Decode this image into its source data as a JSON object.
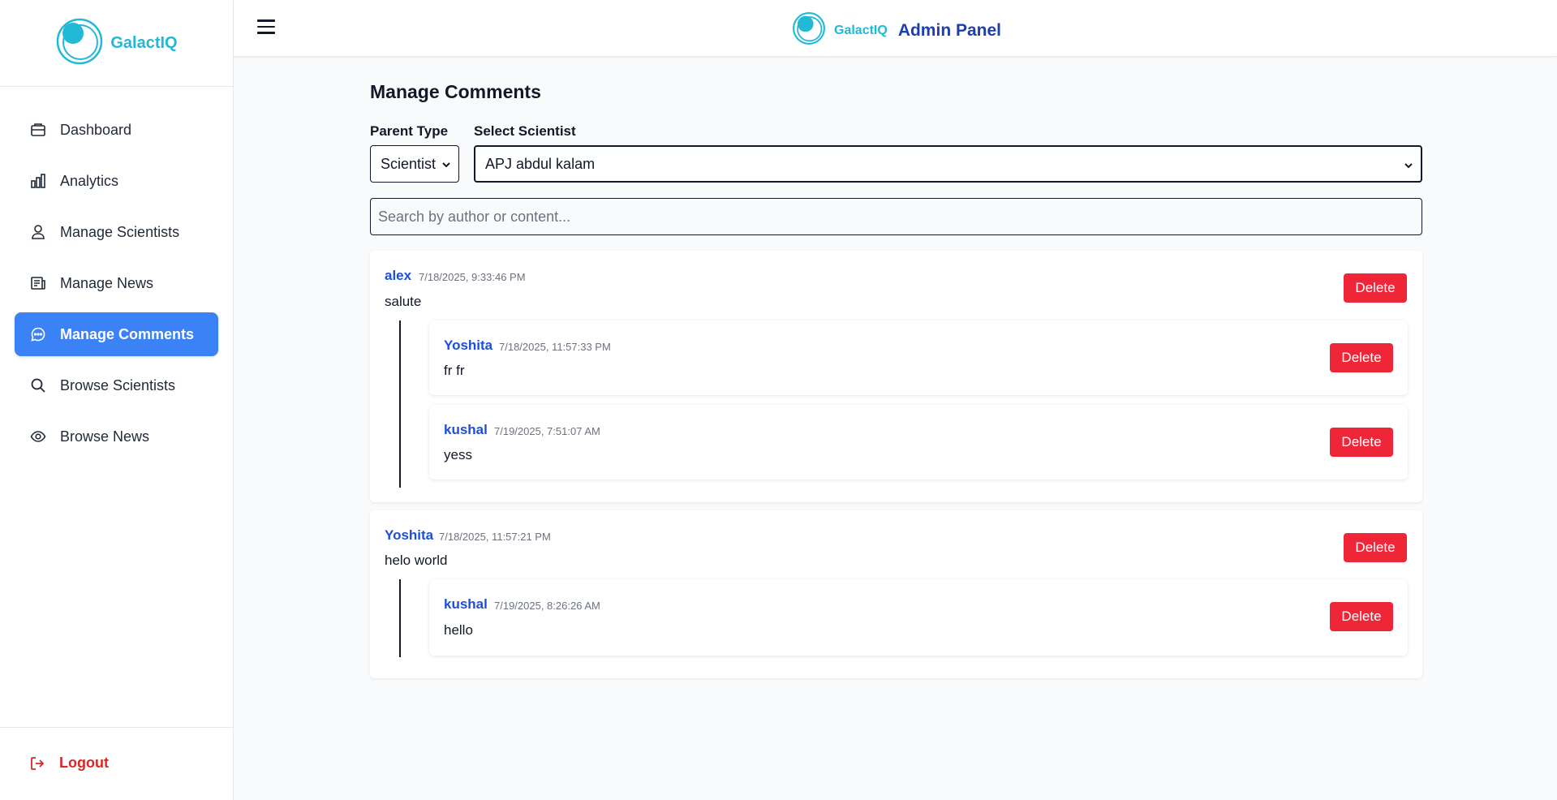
{
  "brand": {
    "name": "GalactIQ"
  },
  "header": {
    "brand": "GalactIQ",
    "title": "Admin Panel"
  },
  "sidebar": {
    "items": [
      {
        "label": "Dashboard",
        "icon": "dashboard-icon"
      },
      {
        "label": "Analytics",
        "icon": "bar-chart-icon"
      },
      {
        "label": "Manage Scientists",
        "icon": "user-icon"
      },
      {
        "label": "Manage News",
        "icon": "newspaper-icon"
      },
      {
        "label": "Manage Comments",
        "icon": "comment-icon",
        "active": true
      },
      {
        "label": "Browse Scientists",
        "icon": "search-icon"
      },
      {
        "label": "Browse News",
        "icon": "eye-icon"
      }
    ],
    "logout": "Logout"
  },
  "main": {
    "title": "Manage Comments",
    "parent_type": {
      "label": "Parent Type",
      "value": "Scientist"
    },
    "scientist": {
      "label": "Select Scientist",
      "value": "APJ abdul kalam"
    },
    "search_placeholder": "Search by author or content...",
    "delete_label": "Delete",
    "comments": [
      {
        "author": "alex",
        "time": "7/18/2025, 9:33:46 PM",
        "text": "salute",
        "replies": [
          {
            "author": "Yoshita",
            "time": "7/18/2025, 11:57:33 PM",
            "text": "fr fr"
          },
          {
            "author": "kushal",
            "time": "7/19/2025, 7:51:07 AM",
            "text": "yess"
          }
        ]
      },
      {
        "author": "Yoshita",
        "time": "7/18/2025, 11:57:21 PM",
        "text": "helo world",
        "replies": [
          {
            "author": "kushal",
            "time": "7/19/2025, 8:26:26 AM",
            "text": "hello"
          }
        ]
      }
    ]
  },
  "colors": {
    "accent": "#3b82f6",
    "brand": "#22b8d8",
    "author": "#1d4ed8",
    "danger": "#ef2638"
  }
}
